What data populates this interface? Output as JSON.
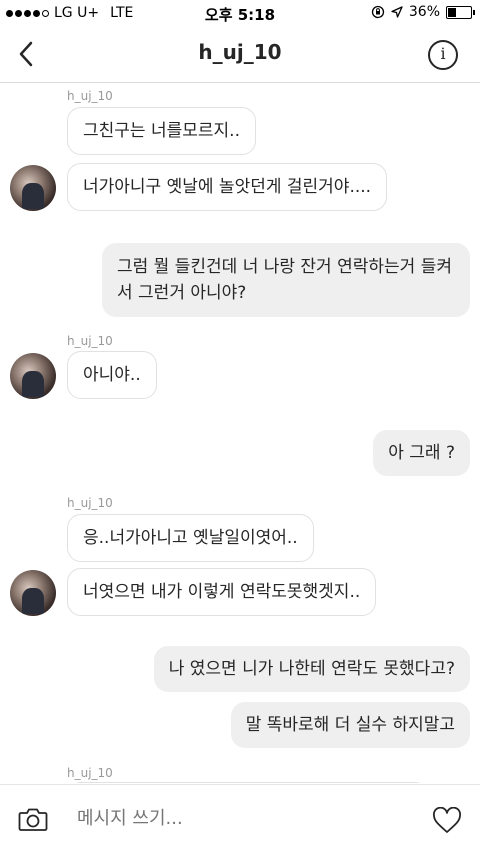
{
  "status_bar": {
    "carrier": "LG U+",
    "network": "LTE",
    "time": "오후 5:18",
    "battery": "36%",
    "signal_bars_filled": 4,
    "signal_bars_total": 5,
    "battery_level": 0.36
  },
  "header": {
    "title": "h_uj_10",
    "back_icon": "chevron-left-icon",
    "info_icon": "info-icon"
  },
  "messages": [
    {
      "dir": "in",
      "user": "h_uj_10",
      "text": "그친구는 너를모르지.."
    },
    {
      "dir": "in",
      "text": "너가아니구 옛날에 놀앗던게 걸린거야...."
    },
    {
      "dir": "out",
      "text": "그럼 뭘 들킨건데 너 나랑 잔거 연락하는거 들켜서 그런거 아니야?"
    },
    {
      "dir": "in",
      "user": "h_uj_10",
      "text": "아니야.."
    },
    {
      "dir": "out",
      "text": "아 그래 ?"
    },
    {
      "dir": "in",
      "user": "h_uj_10",
      "text": "응..너가아니고 옛날일이엿어.."
    },
    {
      "dir": "in",
      "text": "너엿으면 내가 이렇게 연락도못햇겟지.."
    },
    {
      "dir": "out",
      "text": "나 였으면 니가 나한테  연락도 못했다고?"
    },
    {
      "dir": "out",
      "text": "말 똑바로해 더 실수 하지말고"
    },
    {
      "dir": "in",
      "user": "h_uj_10"
    }
  ],
  "composer": {
    "placeholder": "메시지 쓰기...",
    "camera_icon": "camera-icon",
    "heart_icon": "heart-icon"
  }
}
